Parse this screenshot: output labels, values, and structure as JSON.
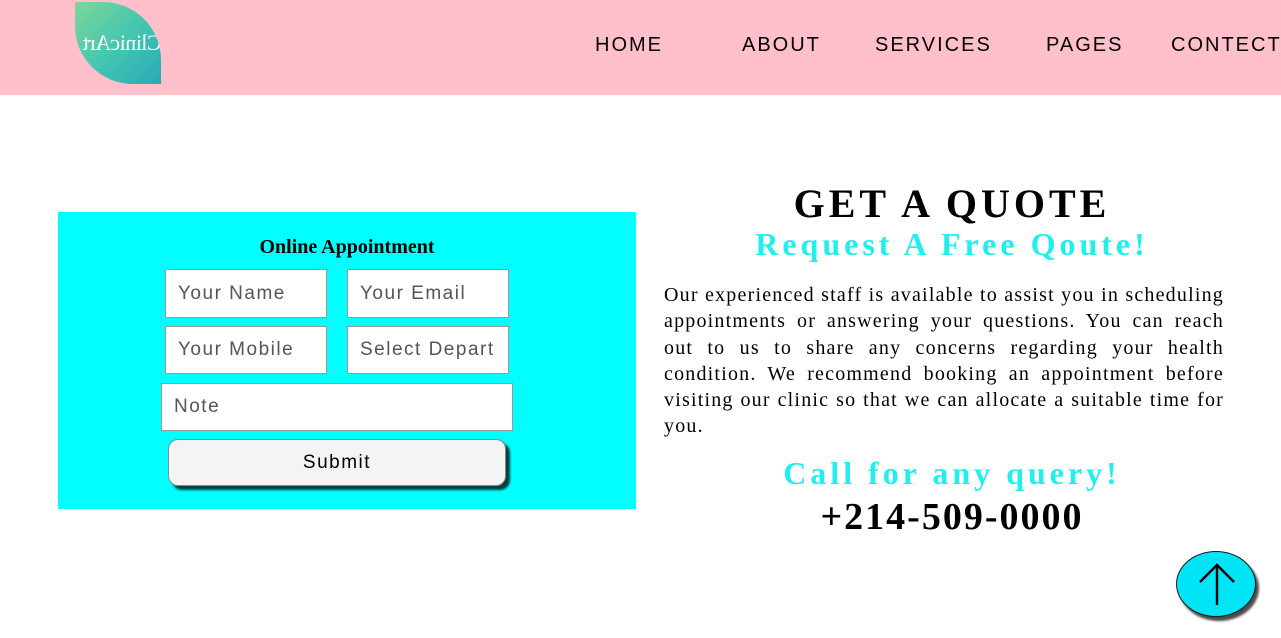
{
  "header": {
    "logo_text": "ClinicArt",
    "nav": [
      "HOME",
      "ABOUT",
      "SERVICES",
      "PAGES",
      "CONTECT"
    ]
  },
  "form": {
    "title": "Online Appointment",
    "name_placeholder": "Your Name",
    "email_placeholder": "Your Email",
    "mobile_placeholder": "Your Mobile",
    "department_placeholder": "Select Department",
    "note_placeholder": "Note",
    "submit_label": "Submit"
  },
  "quote": {
    "title": "GET A QUOTE",
    "subtitle": "Request A Free Qoute!",
    "paragraph": "Our experienced staff is available to assist you in scheduling appointments or answering your questions. You can reach out to us to share any concerns regarding your health condition. We recommend booking an appointment before visiting our clinic so that we can allocate a suitable time for you.",
    "call_text": "Call for any query!",
    "phone": "+214-509-0000"
  },
  "colors": {
    "header_bg": "#ffc0cb",
    "form_bg": "#00ffff",
    "accent_text": "#22eeee",
    "scroll_button": "#00e5f5"
  },
  "icons": {
    "scroll_top": "arrow-up-icon"
  }
}
